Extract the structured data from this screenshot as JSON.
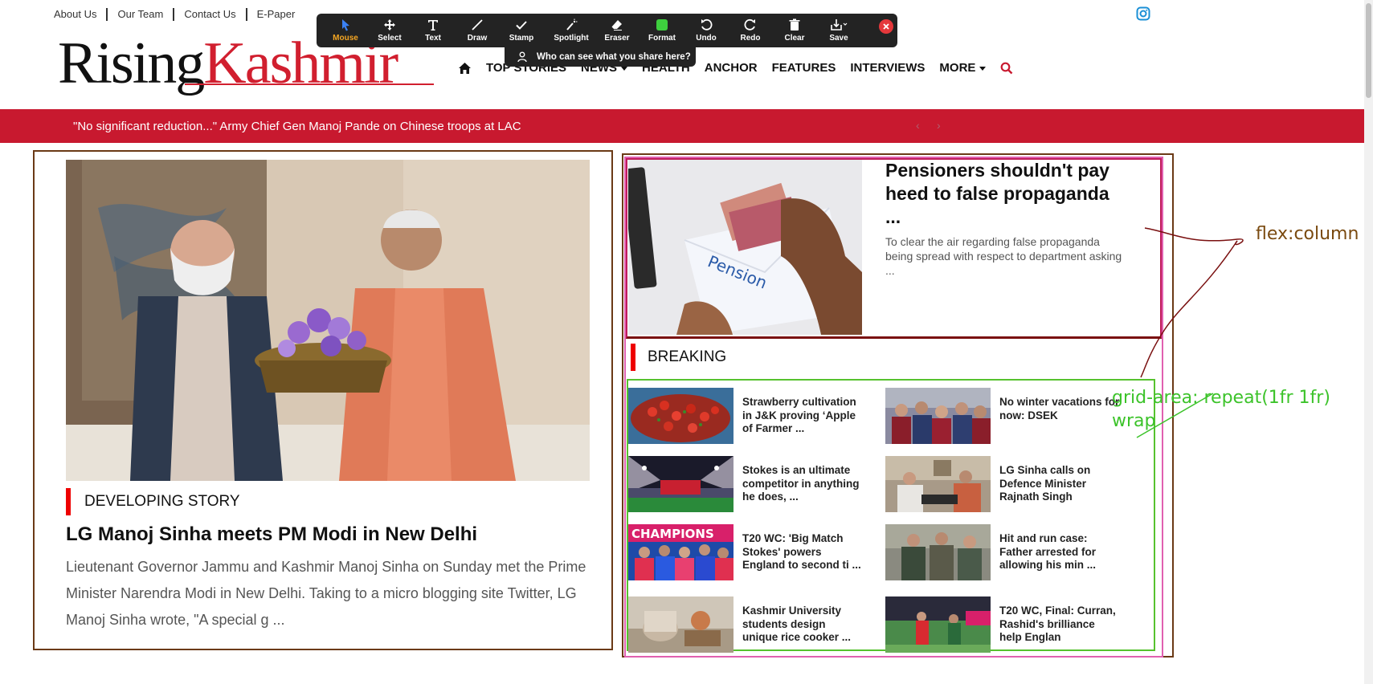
{
  "top_links": [
    "About Us",
    "Our Team",
    "Contact Us",
    "E-Paper"
  ],
  "logo": {
    "part1": "Rising",
    "part2": "Kashmir"
  },
  "nav": {
    "items": [
      "TOP STORIES",
      "NEWS",
      "HEALTH",
      "ANCHOR",
      "FEATURES",
      "INTERVIEWS",
      "MORE"
    ]
  },
  "toolbar": {
    "buttons": [
      "Mouse",
      "Select",
      "Text",
      "Draw",
      "Stamp",
      "Spotlight",
      "Eraser",
      "Format",
      "Undo",
      "Redo",
      "Clear",
      "Save"
    ],
    "share_banner": "Who can see what you share here?"
  },
  "ticker": {
    "text": "\"No significant reduction...\" Army Chief Gen Manoj Pande on Chinese troops at LAC"
  },
  "feature": {
    "tag": "DEVELOPING STORY",
    "title": "LG Manoj Sinha meets PM Modi in New Delhi",
    "description": "Lieutenant Governor Jammu and Kashmir Manoj Sinha on Sunday met the Prime Minister Narendra Modi in New Delhi.     Taking to a micro blogging site Twitter, LG Manoj Sinha wrote, \"A special g ..."
  },
  "pension": {
    "title": "Pensioners shouldn't pay heed to false propaganda ...",
    "description": "To clear the air regarding false propaganda being spread with respect to department asking ...",
    "image_text": "Pension"
  },
  "breaking": {
    "label": "BREAKING",
    "items": [
      {
        "title": "Strawberry cultivation in J&K proving ‘Apple of Farmer ..."
      },
      {
        "title": "No winter vacations for now: DSEK"
      },
      {
        "title": "Stokes is an ultimate competitor in anything he does, ..."
      },
      {
        "title": "LG Sinha calls on Defence Minister Rajnath Singh"
      },
      {
        "title": "T20 WC: 'Big Match Stokes' powers England to second ti ..."
      },
      {
        "title": "Hit and run case: Father arrested for allowing his min ..."
      },
      {
        "title": "Kashmir University students design unique rice cooker ..."
      },
      {
        "title": "T20 WC, Final: Curran, Rashid's brilliance help Englan"
      }
    ],
    "thumb_text_champions": "CHAMPIONS"
  },
  "annotations": {
    "flex": "flex:column",
    "grid_line1": "grid-area: repeat(1fr 1fr)",
    "grid_line2": "wrap"
  },
  "colors": {
    "brand_red": "#c8192f",
    "logo_red": "#d11f2f",
    "annot_green": "#3cc32a",
    "annot_brown": "#7a4a10"
  }
}
